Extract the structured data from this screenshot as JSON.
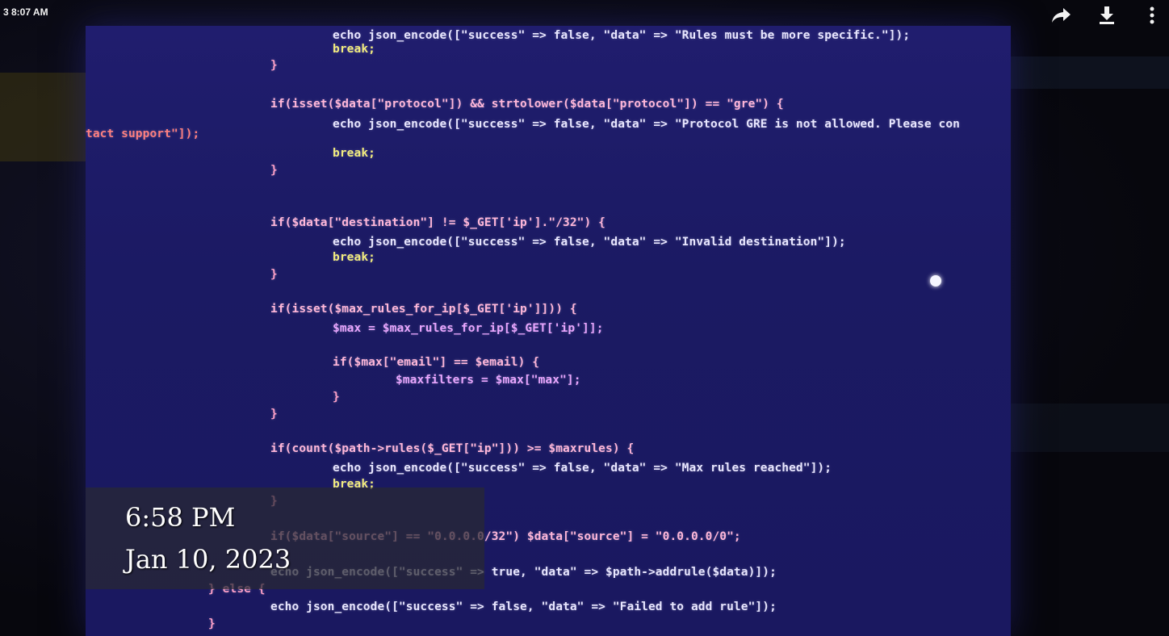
{
  "status_bar": {
    "time": "3 8:07 AM"
  },
  "icons": {
    "share": "share-icon",
    "download": "download-icon",
    "more": "more-icon"
  },
  "overlay": {
    "time": "6:58 PM",
    "date": "Jan 10, 2023"
  },
  "code_lines": [
    "echo json_encode([\"success\" => false, \"data\" => \"Rules must be more specific.\"]);",
    "break;",
    "}",
    "if(isset($data[\"protocol\"]) && strtolower($data[\"protocol\"]) == \"gre\") {",
    "echo json_encode([\"success\" => false, \"data\" => \"Protocol GRE is not allowed. Please con",
    "tact support\"]);",
    "break;",
    "}",
    "if($data[\"destination\"] != $_GET['ip'].\"/32\") {",
    "echo json_encode([\"success\" => false, \"data\" => \"Invalid destination\"]);",
    "break;",
    "}",
    "if(isset($max_rules_for_ip[$_GET['ip']])) {",
    "$max = $max_rules_for_ip[$_GET['ip']];",
    "if($max[\"email\"] == $email) {",
    "$maxfilters = $max[\"max\"];",
    "}",
    "}",
    "if(count($path->rules($_GET[\"ip\"])) >= $maxrules) {",
    "echo json_encode([\"success\" => false, \"data\" => \"Max rules reached\"]);",
    "break;",
    "}",
    "if($data[\"source\"] == \"0.0.0.0/32\") $data[\"source\"] = \"0.0.0.0/0\";",
    "echo json_encode([\"success\" => true, \"data\" => $path->addrule($data)]);",
    "} else {",
    "echo json_encode([\"success\" => false, \"data\" => \"Failed to add rule\"]);",
    "}"
  ]
}
